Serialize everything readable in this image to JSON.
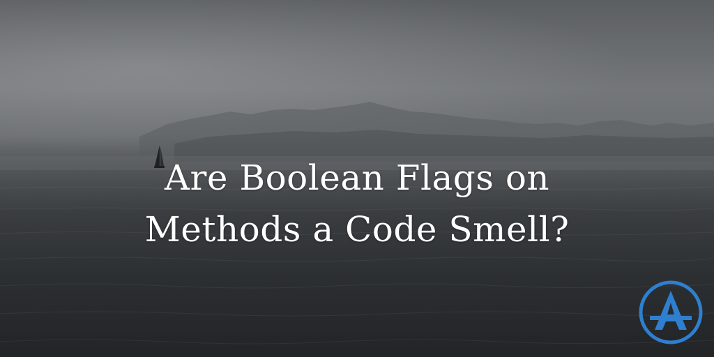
{
  "post": {
    "title_line_1": "Are Boolean Flags on",
    "title_line_2": "Methods a Code Smell?"
  },
  "logo": {
    "icon": "letter-a-logo",
    "color": "#2f7fd0"
  },
  "colors": {
    "text": "#ffffff",
    "accent": "#2f7fd0"
  }
}
